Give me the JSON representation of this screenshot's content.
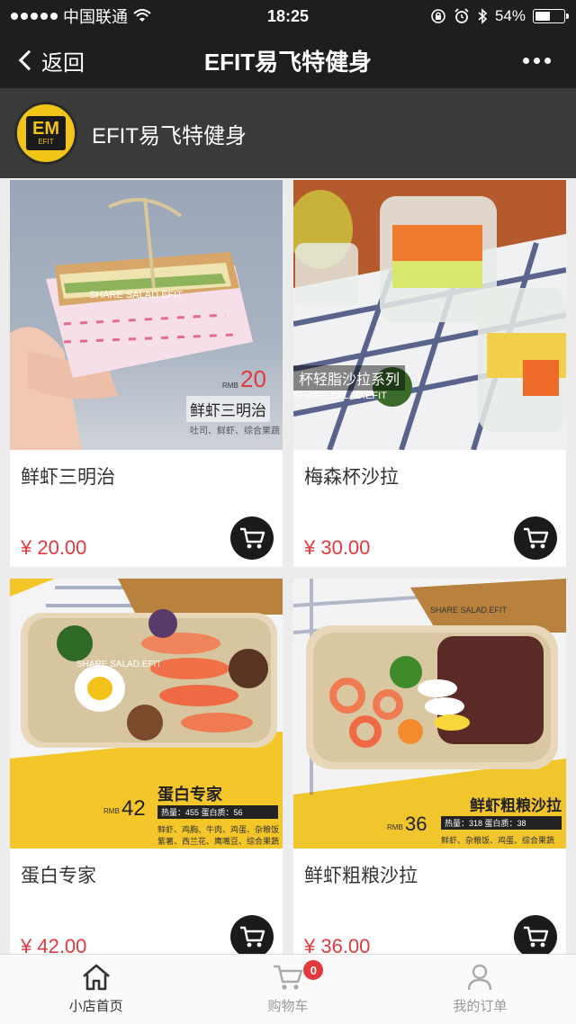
{
  "status": {
    "carrier": "中国联通",
    "time": "18:25",
    "battery": "54%",
    "battery_level": 0.54
  },
  "nav": {
    "back_label": "返回",
    "title": "EFIT易飞特健身"
  },
  "store": {
    "name": "EFIT易飞特健身",
    "logo_mark": "EM",
    "logo_text": "EFIT"
  },
  "products": [
    {
      "name": "鲜虾三明治",
      "price": "¥ 20.00",
      "image_tags": {
        "brand": "SHARE SALAD.EFIT",
        "rmb": "RMB",
        "num": "20",
        "title": "鲜虾三明治",
        "sub": "吐司、鲜虾、综合果蔬"
      }
    },
    {
      "name": "梅森杯沙拉",
      "price": "¥ 30.00",
      "image_tags": {
        "brand": "SHARE SALAD.EFIT",
        "title": "杯轻脂沙拉系列"
      }
    },
    {
      "name": "蛋白专家",
      "price": "¥ 42.00",
      "image_tags": {
        "brand": "SHARE SALAD.EFIT",
        "rmb": "RMB",
        "num": "42",
        "title": "蛋白专家",
        "stats": "热量：455    蛋白质：56",
        "sub1": "鲜虾、鸡胸、牛肉、鸡蛋、杂粮饭",
        "sub2": "紫薯、西兰花、鹰嘴豆、综合果蔬"
      }
    },
    {
      "name": "鲜虾粗粮沙拉",
      "price": "¥ 36.00",
      "image_tags": {
        "brand": "SHARE SALAD.EFIT",
        "rmb": "RMB",
        "num": "36",
        "title": "鲜虾粗粮沙拉",
        "stats": "热量：318    蛋白质：38",
        "sub": "鲜虾、杂粮饭、鸡蛋、综合果蔬"
      }
    }
  ],
  "tabs": [
    {
      "label": "小店首页",
      "active": true
    },
    {
      "label": "购物车",
      "badge": "0"
    },
    {
      "label": "我的订单"
    }
  ],
  "colors": {
    "accent_price": "#e2393e",
    "bar": "#1e1e1f",
    "brand_yellow": "#f2c418"
  }
}
